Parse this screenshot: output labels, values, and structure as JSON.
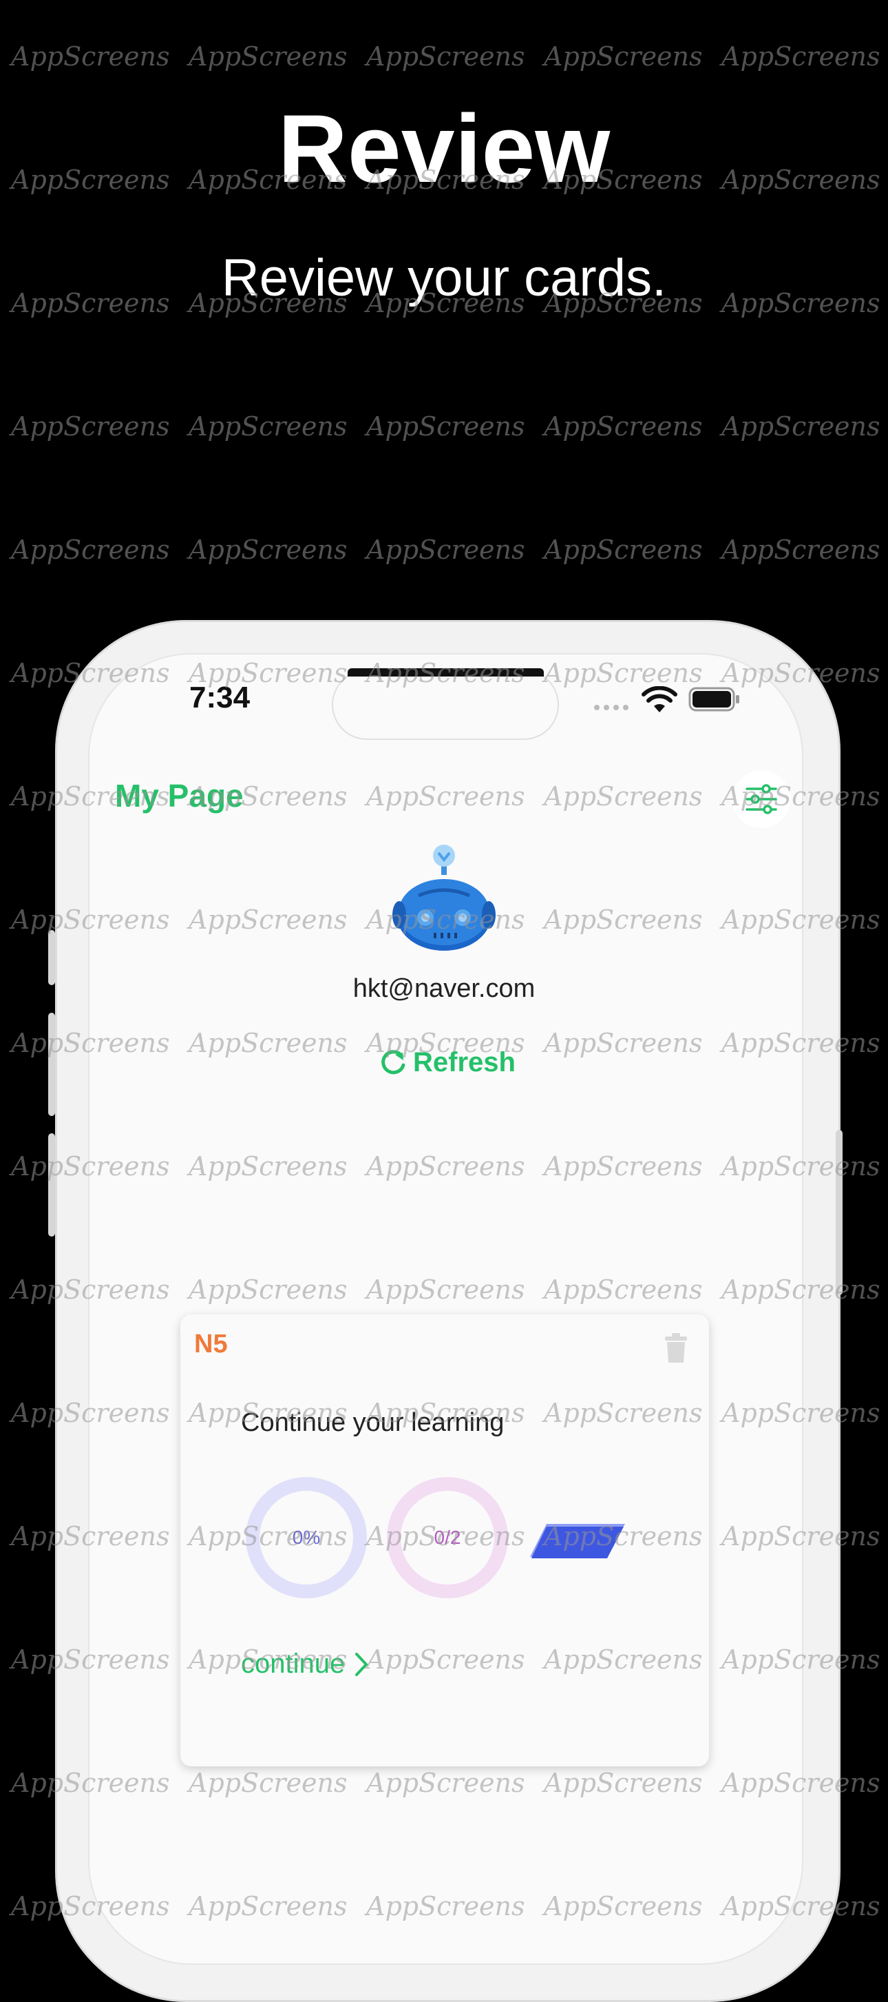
{
  "watermark": {
    "text": "AppScreens"
  },
  "promo": {
    "title": "Review",
    "subtitle": "Review your cards."
  },
  "status_bar": {
    "time": "7:34"
  },
  "header": {
    "title": "My Page",
    "filter_icon": "sliders-icon"
  },
  "profile": {
    "avatar_icon": "robot-avatar-icon",
    "email": "hkt@naver.com",
    "refresh_label": "Refresh"
  },
  "card": {
    "level": "N5",
    "heading": "Continue your learning",
    "progress_label": "0%",
    "progress_fraction": 0,
    "count_label": "0/2",
    "count_fraction": 0,
    "continue_label": "continue"
  },
  "colors": {
    "accent": "#25c069",
    "level": "#f07a3a",
    "ring_progress": "#e1e0fa",
    "ring_count": "#f3ddf3",
    "cards_icon": "#3e57e0"
  }
}
